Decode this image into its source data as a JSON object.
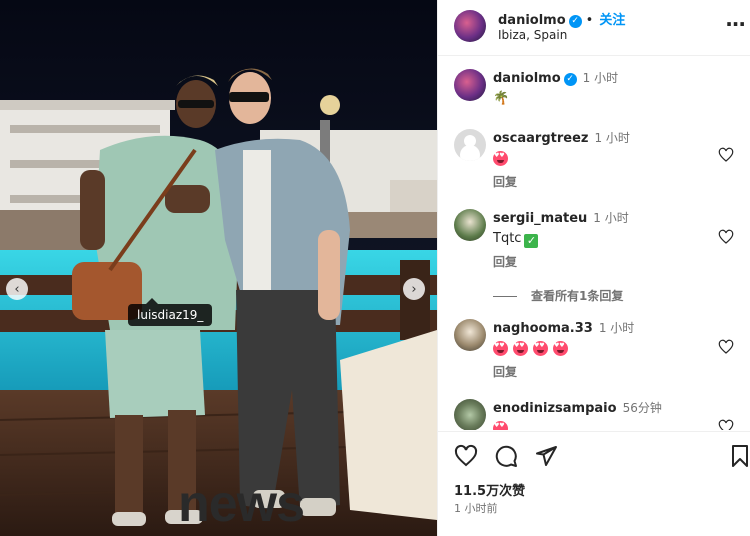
{
  "post": {
    "image_tag": "luisdiaz19_",
    "prev_icon": "chevron-left-icon",
    "next_icon": "chevron-right-icon"
  },
  "header": {
    "username": "daniolmo",
    "verified": "✓",
    "separator": "•",
    "follow_label": "关注",
    "location": "Ibiza, Spain",
    "more_icon": "more-horizontal-icon",
    "more_label": "···"
  },
  "caption": {
    "username": "daniolmo",
    "time": "1 小时",
    "text": "🌴"
  },
  "comments": [
    {
      "username": "oscaargtreez",
      "time": "1 小时",
      "reply_label": "回复",
      "avatar": "default-avatar-icon"
    },
    {
      "username": "sergii_mateu",
      "time": "1 小时",
      "text": "Tqtc",
      "reply_label": "回复"
    },
    {
      "username": "naghooma.33",
      "time": "1 小时",
      "reply_label": "回复"
    },
    {
      "username": "enodinizsampaio",
      "time": "56分钟"
    }
  ],
  "view_replies_label": "查看所有1条回复",
  "actions": {
    "like_icon": "heart-icon",
    "comment_icon": "comment-icon",
    "share_icon": "send-icon",
    "save_icon": "bookmark-icon",
    "likes": "11.5万次赞",
    "posted_ago": "1 小时前"
  },
  "watermark": "news"
}
